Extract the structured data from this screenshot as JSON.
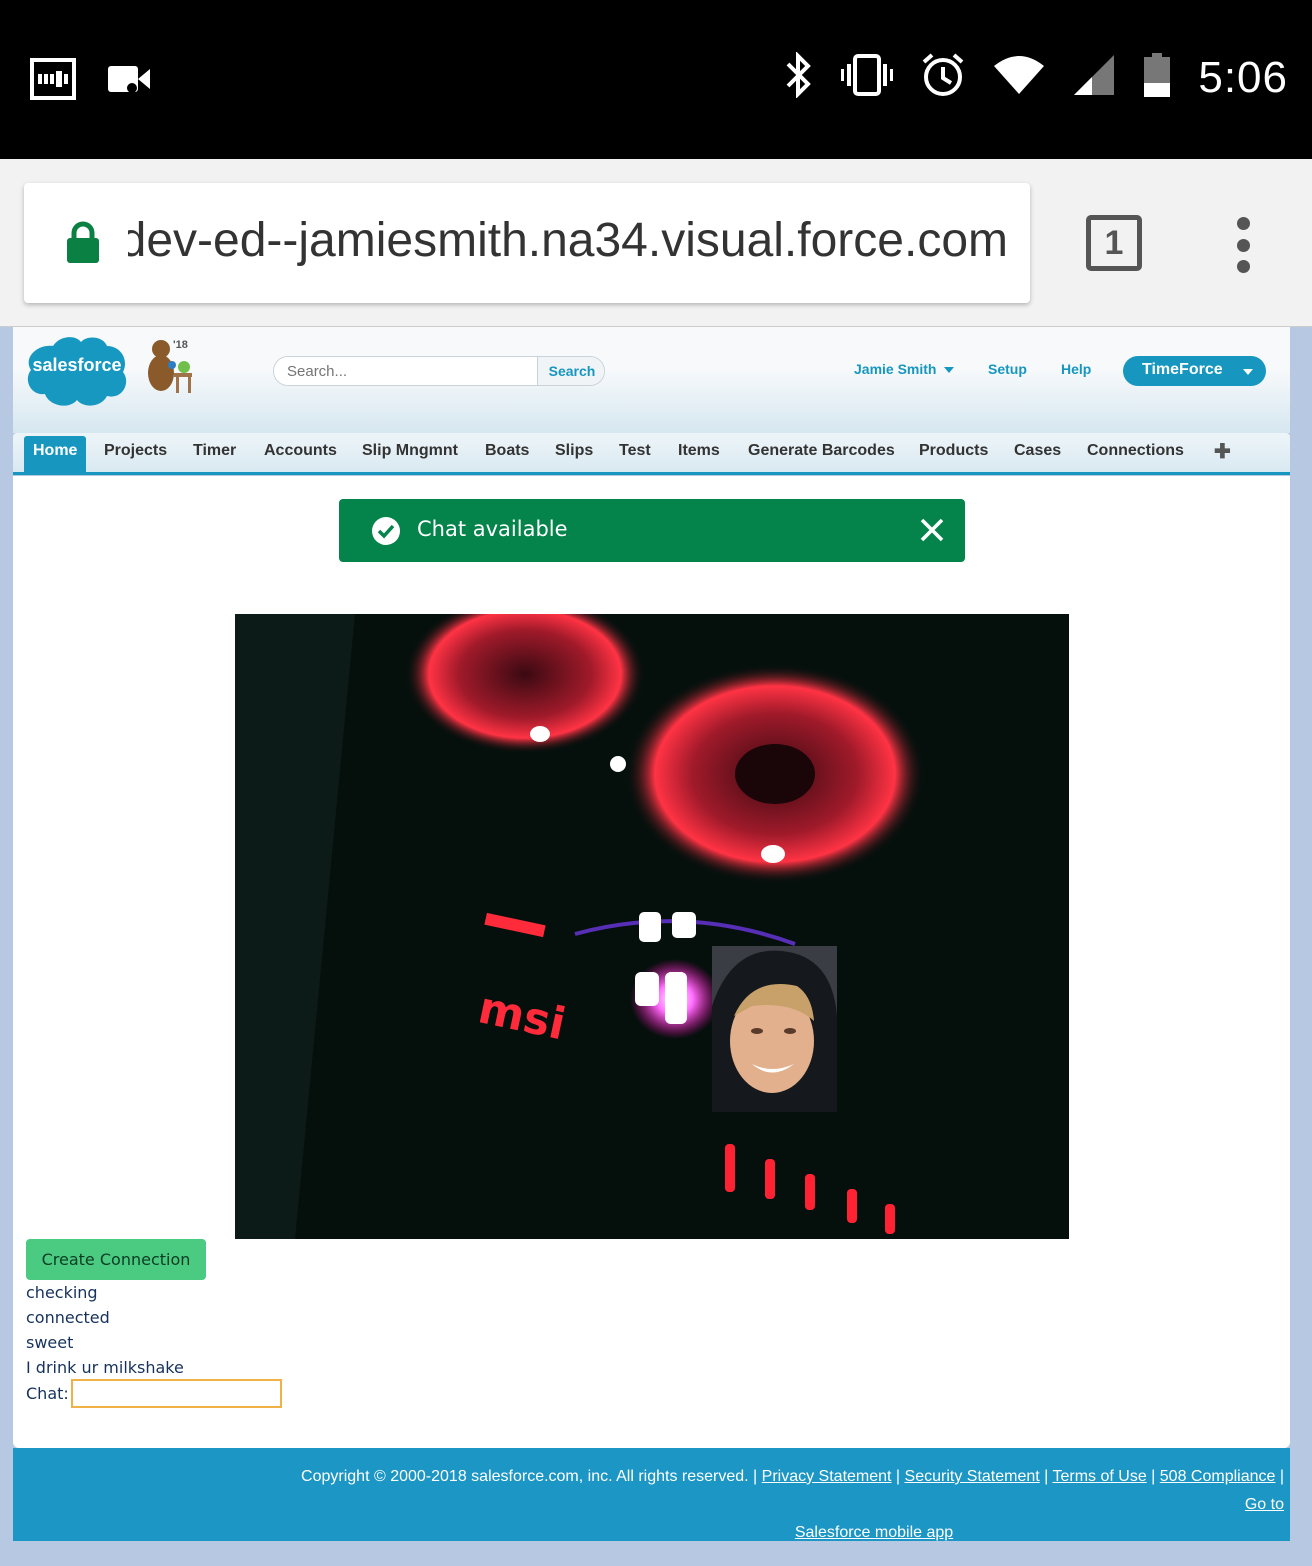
{
  "status_bar": {
    "time": "5:06",
    "left_icons": [
      "cast-screen-icon",
      "video-camera-icon"
    ],
    "right_icons": [
      "bluetooth-icon",
      "vibrate-icon",
      "alarm-icon",
      "wifi-icon",
      "cell-signal-icon",
      "battery-icon"
    ]
  },
  "browser": {
    "url": "dev-ed--jamiesmith.na34.visual.force.com",
    "tab_count": "1"
  },
  "sf_header": {
    "logo_text": "salesforce",
    "badge_year": "'18",
    "search_placeholder": "Search...",
    "search_button": "Search",
    "user_name": "Jamie Smith",
    "setup": "Setup",
    "help": "Help",
    "app_name": "TimeForce"
  },
  "tabs": [
    {
      "label": "Home",
      "active": true
    },
    {
      "label": "Projects"
    },
    {
      "label": "Timer"
    },
    {
      "label": "Accounts"
    },
    {
      "label": "Slip Mngmnt"
    },
    {
      "label": "Boats"
    },
    {
      "label": "Slips"
    },
    {
      "label": "Test"
    },
    {
      "label": "Items"
    },
    {
      "label": "Generate Barcodes"
    },
    {
      "label": "Products"
    },
    {
      "label": "Cases"
    },
    {
      "label": "Connections"
    }
  ],
  "toast": {
    "message": "Chat available",
    "color": "#04844b"
  },
  "actions": {
    "create_connection": "Create Connection"
  },
  "log": [
    "checking",
    "connected",
    "sweet",
    "I drink ur milkshake"
  ],
  "chat": {
    "label": "Chat:",
    "value": ""
  },
  "footer": {
    "copyright": "Copyright © 2000-2018 salesforce.com, inc. All rights reserved.",
    "privacy": "Privacy Statement",
    "security": "Security Statement",
    "terms": "Terms of Use",
    "compliance": "508 Compliance",
    "mobile_1": "Go to",
    "mobile_2": "Salesforce mobile app"
  },
  "colors": {
    "salesforce_blue": "#1797c0",
    "footer_blue": "#1b96c5",
    "create_button": "#4bca81",
    "chat_border": "#f0b247"
  }
}
